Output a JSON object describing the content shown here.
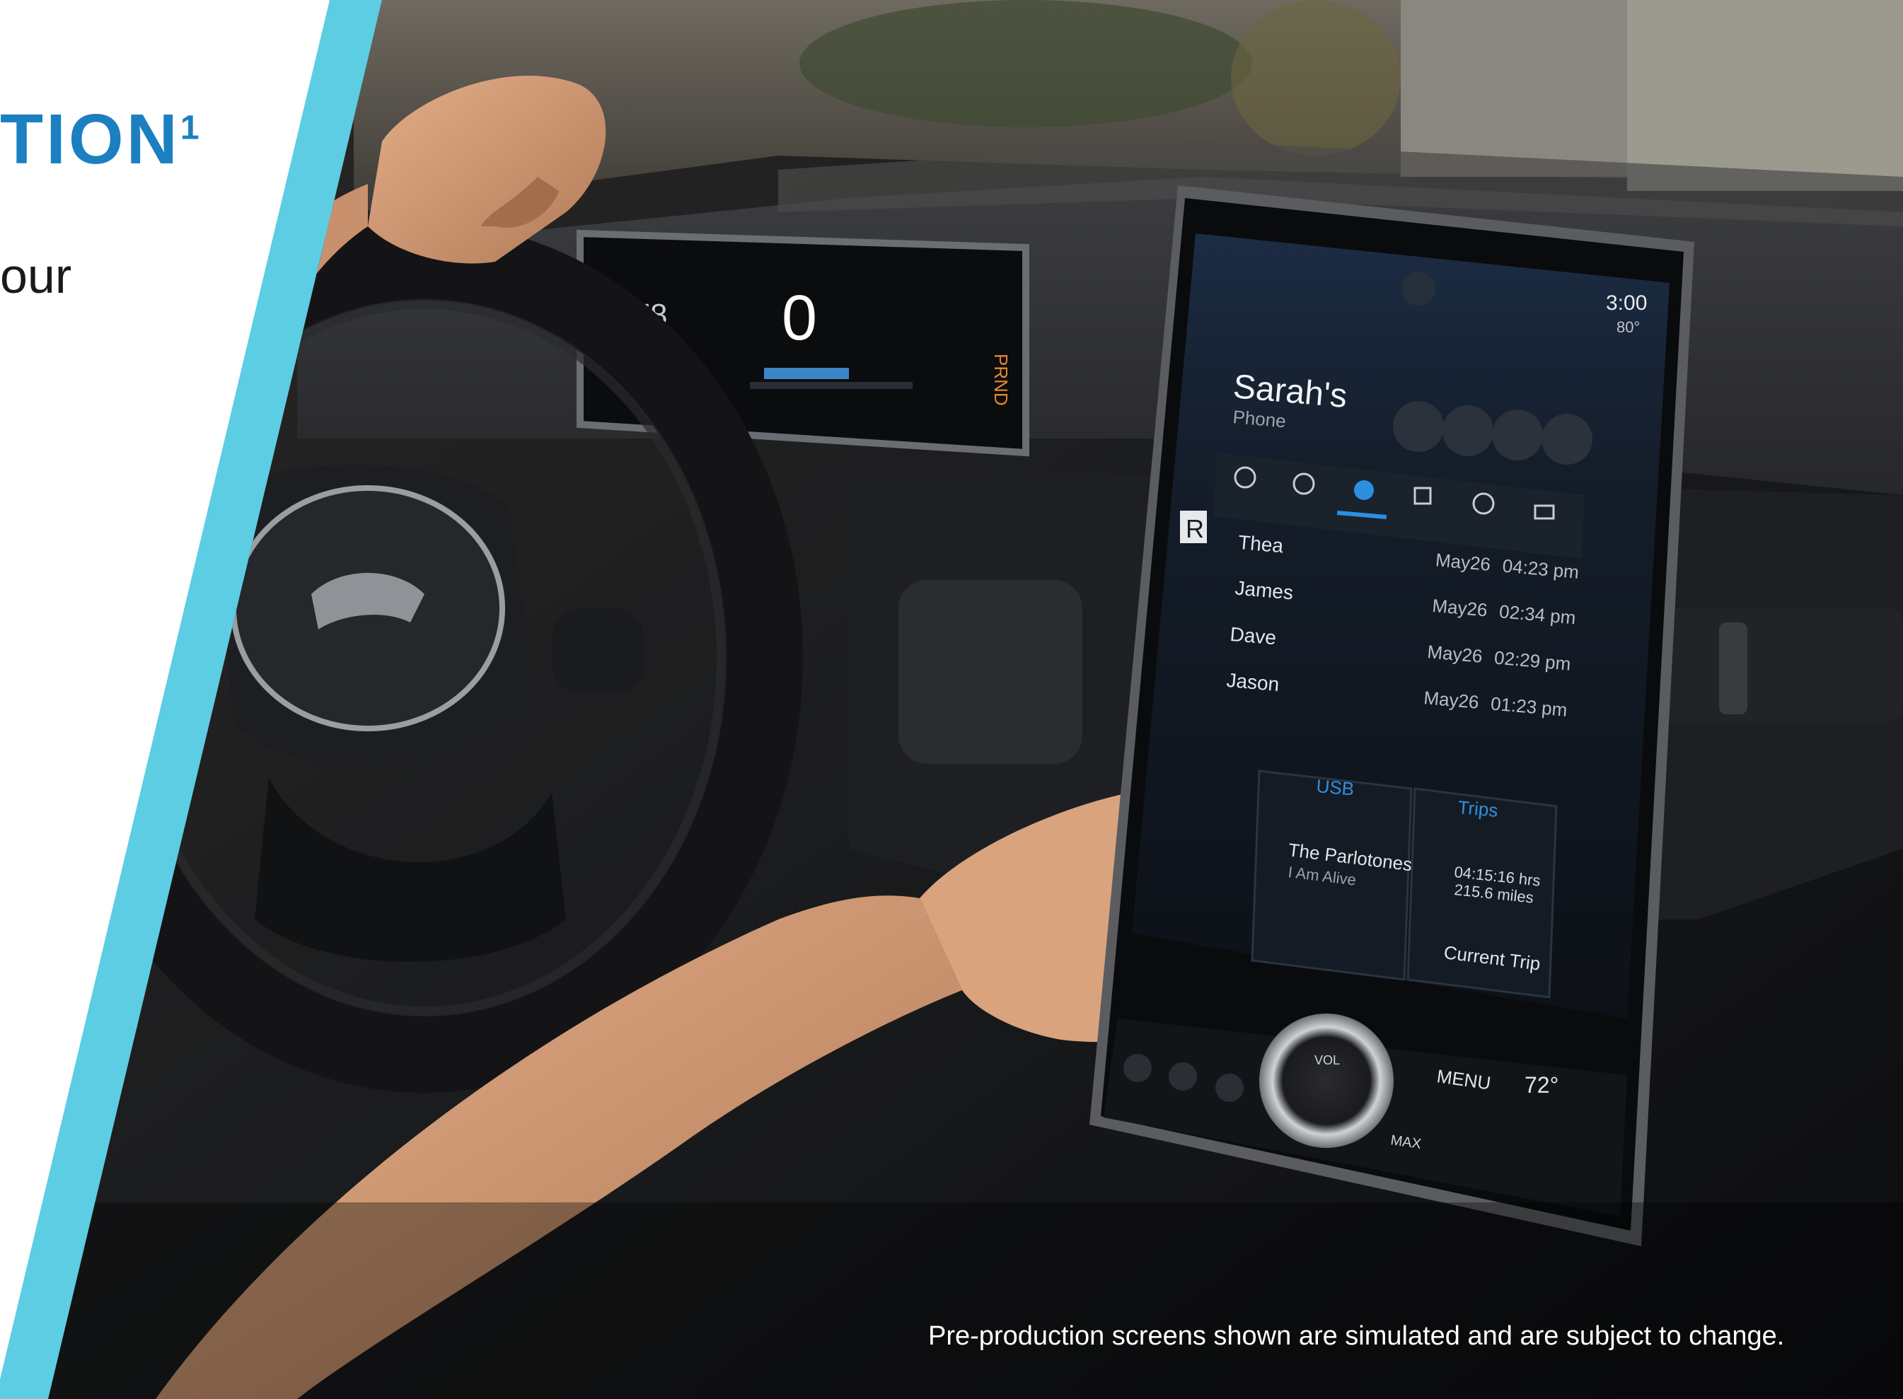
{
  "heading": {
    "text": "TION",
    "superscript": "1"
  },
  "body_fragment": "our",
  "disclaimer": "Pre-production screens shown are simulated and are subject to change.",
  "cluster": {
    "range": "178",
    "speed": "0",
    "gear": "PRND"
  },
  "infotainment": {
    "time": "3:00",
    "status": "80°",
    "device_name": "Sarah's",
    "device_type": "Phone",
    "index_letter": "R",
    "calls": [
      {
        "name": "Thea",
        "date": "May26",
        "time": "04:23 pm"
      },
      {
        "name": "James",
        "date": "May26",
        "time": "02:34 pm"
      },
      {
        "name": "Dave",
        "date": "May26",
        "time": "02:29 pm"
      },
      {
        "name": "Jason",
        "date": "May26",
        "time": "01:23 pm"
      }
    ],
    "media": {
      "source": "USB",
      "artist": "The Parlotones",
      "track": "I Am Alive"
    },
    "trip": {
      "title": "Trips",
      "duration": "04:15:16 hrs",
      "distance": "215.6 miles",
      "label": "Current Trip"
    },
    "controls": {
      "menu": "MENU",
      "temperature": "72°",
      "volume": "VOL",
      "defrost": "MAX"
    }
  },
  "colors": {
    "accent_stripe": "#5ccde3",
    "heading_blue": "#1c7fc0",
    "screen_blue": "#2d8fe0"
  }
}
